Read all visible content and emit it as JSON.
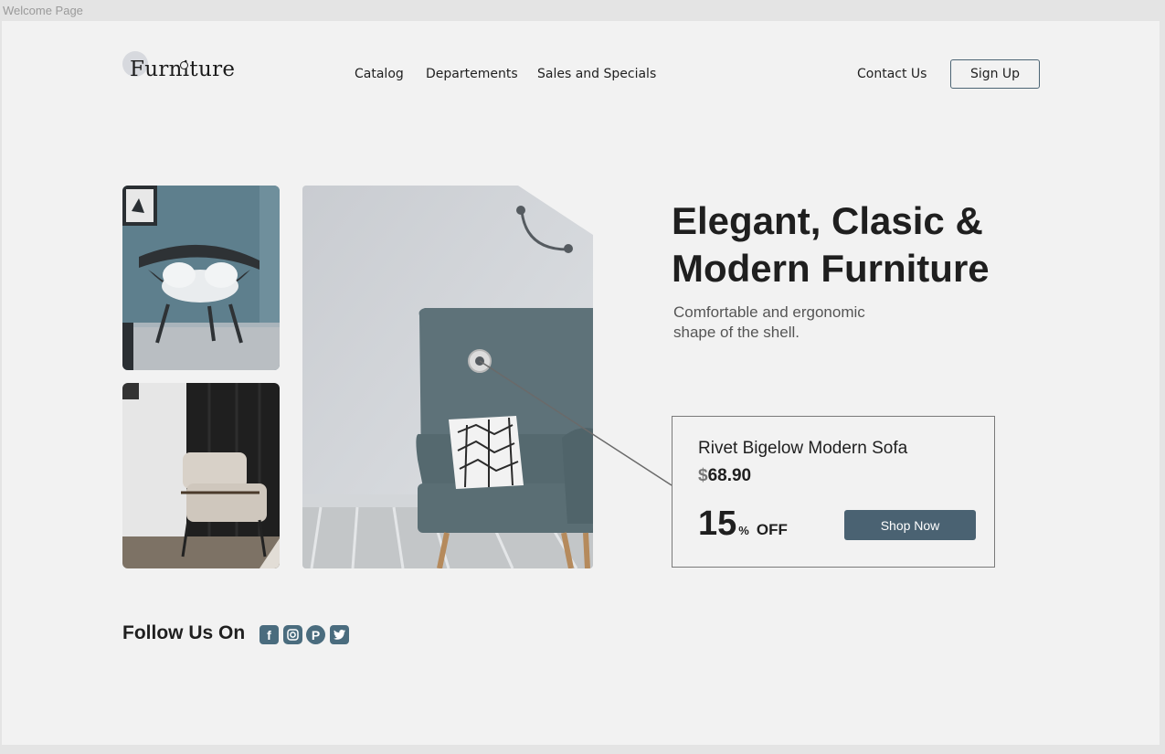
{
  "window": {
    "title": "Welcome Page"
  },
  "brand": {
    "logo_text": "Furniture"
  },
  "nav": {
    "items": [
      {
        "label": "Catalog"
      },
      {
        "label": "Departements"
      },
      {
        "label": "Sales and Specials"
      }
    ],
    "contact_label": "Contact Us",
    "signup_label": "Sign Up"
  },
  "hero": {
    "headline_line1": "Elegant, Clasic &",
    "headline_line2": "Modern Furniture",
    "subtitle_line1": "Comfortable and ergonomic",
    "subtitle_line2": "shape of the shell."
  },
  "product": {
    "name": "Rivet Bigelow Modern Sofa",
    "currency": "$",
    "price": "68.90",
    "discount_value": "15",
    "discount_unit": "%",
    "discount_label": "OFF",
    "cta_label": "Shop Now"
  },
  "social": {
    "label": "Follow Us On",
    "icons": [
      "facebook-icon",
      "instagram-icon",
      "pinterest-icon",
      "twitter-icon"
    ]
  },
  "colors": {
    "accent": "#4a6272",
    "background": "#f2f2f2",
    "text": "#1f1f1f"
  }
}
